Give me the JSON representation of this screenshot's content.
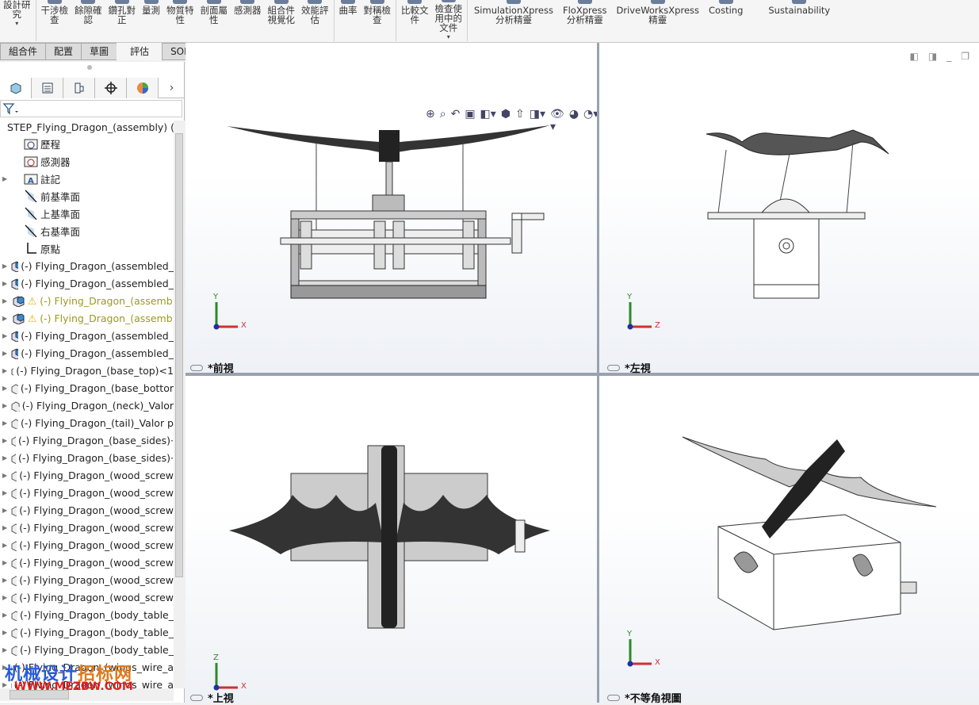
{
  "ribbon": {
    "items": [
      {
        "label": "設計研\n究",
        "arrow": true
      },
      {
        "label": "干涉檢\n查"
      },
      {
        "label": "餘隙確\n認"
      },
      {
        "label": "鑽孔對\n正"
      },
      {
        "label": "量測"
      },
      {
        "label": "物質特\n性"
      },
      {
        "label": "剖面屬\n性"
      },
      {
        "label": "感測器"
      },
      {
        "label": "組合件\n視覺化"
      },
      {
        "label": "效能評\n估"
      },
      {
        "label": "曲率"
      },
      {
        "label": "對稱檢\n查"
      },
      {
        "label": "比較文\n件"
      },
      {
        "label": "檢查使\n用中的\n文件",
        "arrow": true
      },
      {
        "label": "SimulationXpress\n分析精靈"
      },
      {
        "label": "FloXpress\n分析精靈"
      },
      {
        "label": "DriveWorksXpress\n精靈"
      },
      {
        "label": "Costing"
      },
      {
        "label": "Sustainability"
      }
    ]
  },
  "tabs": [
    {
      "label": "組合件"
    },
    {
      "label": "配置"
    },
    {
      "label": "草圖"
    },
    {
      "label": "評估",
      "active": true
    },
    {
      "label": "SOLIDWORKS MBD"
    }
  ],
  "tree": {
    "items": [
      {
        "label": "STEP_Flying_Dragon_(assembly)  (預",
        "icon": "assembly",
        "expand": false,
        "indent": 0
      },
      {
        "label": "歷程",
        "icon": "history-folder"
      },
      {
        "label": "感測器",
        "icon": "sensor-folder"
      },
      {
        "label": "註記",
        "icon": "annotation-folder",
        "expand": true
      },
      {
        "label": "前基準面",
        "icon": "plane"
      },
      {
        "label": "上基準面",
        "icon": "plane"
      },
      {
        "label": "右基準面",
        "icon": "plane"
      },
      {
        "label": "原點",
        "icon": "origin"
      },
      {
        "label": "(-) Flying_Dragon_(assembled_",
        "icon": "assembly",
        "expand": true
      },
      {
        "label": "(-) Flying_Dragon_(assembled_",
        "icon": "assembly",
        "expand": true
      },
      {
        "label": "(-) Flying_Dragon_(assemb",
        "icon": "assembly",
        "expand": true,
        "warning": true
      },
      {
        "label": "(-) Flying_Dragon_(assemb",
        "icon": "assembly",
        "expand": true,
        "warning": true
      },
      {
        "label": "(-) Flying_Dragon_(assembled_",
        "icon": "assembly",
        "expand": true
      },
      {
        "label": "(-) Flying_Dragon_(assembled_",
        "icon": "assembly",
        "expand": true
      },
      {
        "label": "(-) Flying_Dragon_(base_top)<1",
        "icon": "part",
        "expand": true
      },
      {
        "label": "(-) Flying_Dragon_(base_bottor",
        "icon": "part",
        "expand": true
      },
      {
        "label": "(-) Flying_Dragon_(neck)_Valor",
        "icon": "part",
        "expand": true
      },
      {
        "label": "(-) Flying_Dragon_(tail)_Valor p",
        "icon": "part",
        "expand": true
      },
      {
        "label": "(-) Flying_Dragon_(base_sides)·",
        "icon": "part",
        "expand": true
      },
      {
        "label": "(-) Flying_Dragon_(base_sides)·",
        "icon": "part",
        "expand": true
      },
      {
        "label": "(-) Flying_Dragon_(wood_screw",
        "icon": "part",
        "expand": true
      },
      {
        "label": "(-) Flying_Dragon_(wood_screw",
        "icon": "part",
        "expand": true
      },
      {
        "label": "(-) Flying_Dragon_(wood_screw",
        "icon": "part",
        "expand": true
      },
      {
        "label": "(-) Flying_Dragon_(wood_screw",
        "icon": "part",
        "expand": true
      },
      {
        "label": "(-) Flying_Dragon_(wood_screw",
        "icon": "part",
        "expand": true
      },
      {
        "label": "(-) Flying_Dragon_(wood_screw",
        "icon": "part",
        "expand": true
      },
      {
        "label": "(-) Flying_Dragon_(wood_screw",
        "icon": "part",
        "expand": true
      },
      {
        "label": "(-) Flying_Dragon_(wood_screw",
        "icon": "part",
        "expand": true
      },
      {
        "label": "(-) Flying_Dragon_(body_table_",
        "icon": "part",
        "expand": true
      },
      {
        "label": "(-) Flying_Dragon_(body_table_",
        "icon": "part",
        "expand": true
      },
      {
        "label": "(-) Flying_Dragon_(body_table_",
        "icon": "part",
        "expand": true
      },
      {
        "label": "(-) Flying_Dragon_(wings_wire_a",
        "icon": "part",
        "expand": true
      },
      {
        "label": "(-) Flying_Dragon_(wings_wire_a",
        "icon": "part",
        "expand": true
      }
    ]
  },
  "viewports": {
    "front": "*前視",
    "left": "*左視",
    "top": "*上視",
    "iso": "*不等角視圖"
  },
  "axes": {
    "x": "X",
    "y": "Y",
    "z": "Z"
  },
  "watermark": {
    "line1a": "机械设计",
    "line1b": "招标网",
    "line2": "WWW.MEZBW.COM"
  },
  "colors": {
    "warning": "#9a9a20",
    "x_axis": "#d03030",
    "y_axis": "#2a8a2a",
    "z_axis": "#2030a0"
  }
}
